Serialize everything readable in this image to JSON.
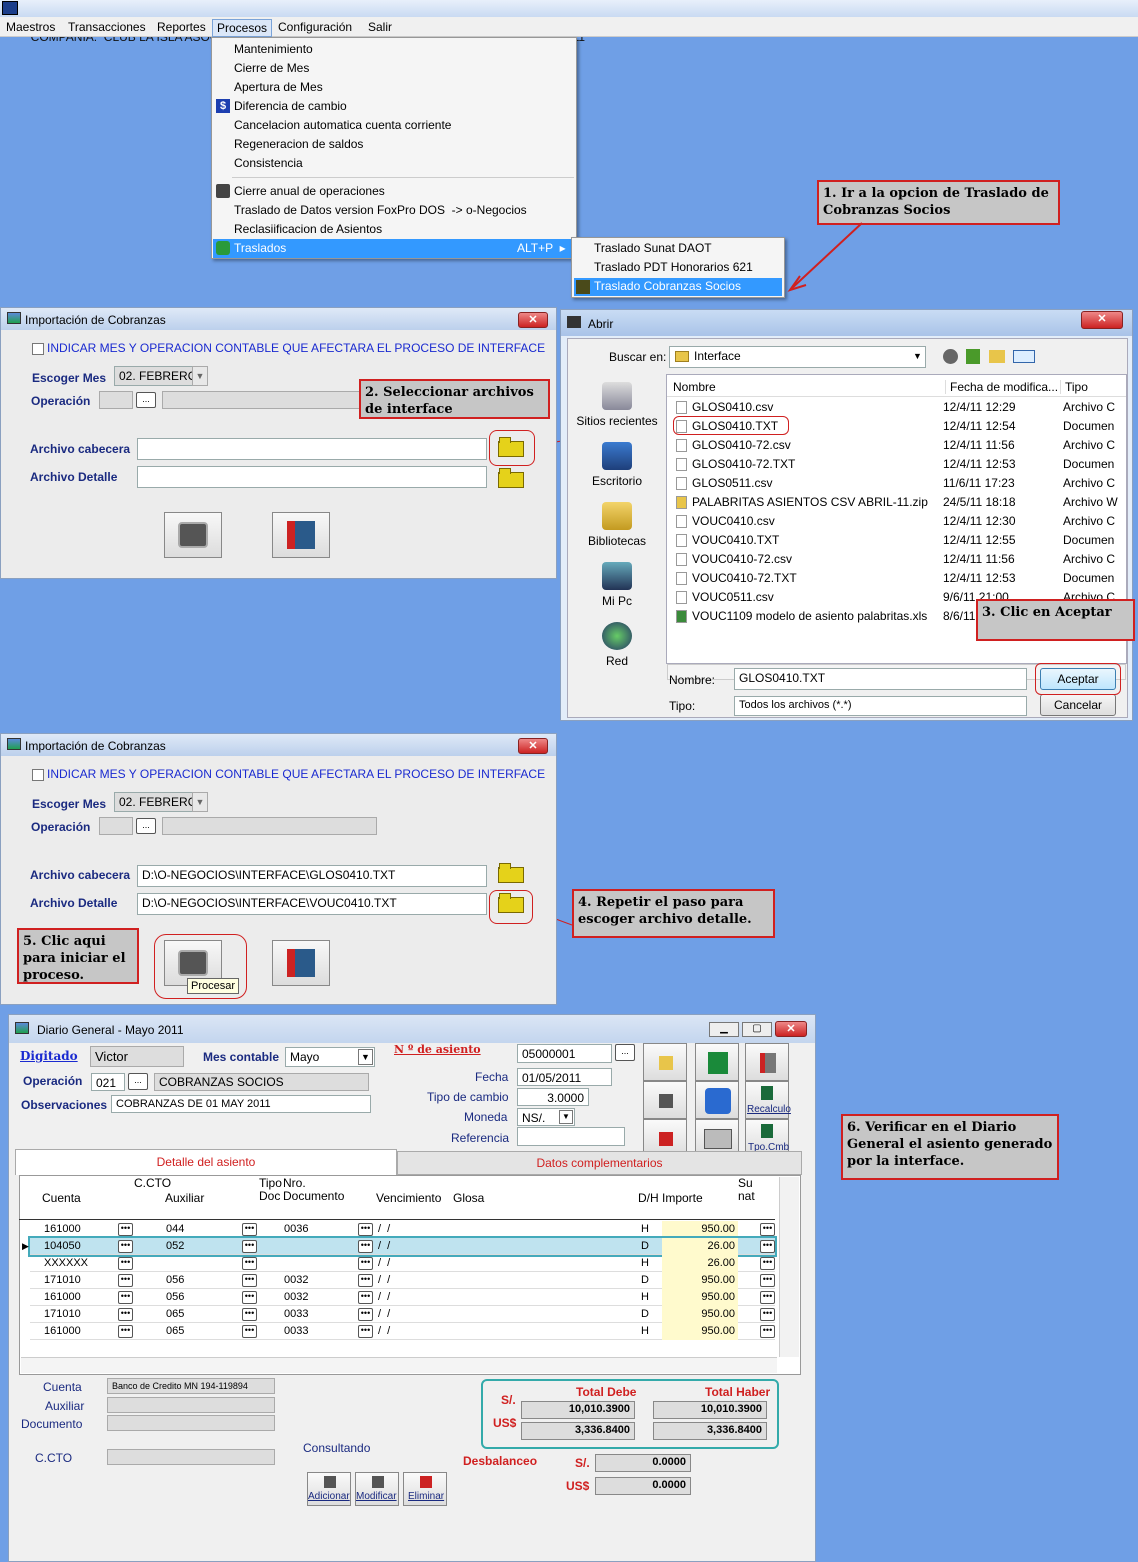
{
  "app": {
    "title": "COMPAÑIA:  CLUB LA ISLA ASOCIACION CIVIL   -   CONTABILIDAD   -   PERIODO: FEBRERO - 2011"
  },
  "menubar": [
    "Maestros",
    "Transacciones",
    "Reportes",
    "Procesos",
    "Configuración",
    "Salir"
  ],
  "procesos_menu": {
    "items": [
      "Mantenimiento",
      "Cierre de Mes",
      "Apertura de Mes",
      "Diferencia de cambio",
      "Cancelacion automatica cuenta corriente",
      "Regeneracion de saldos",
      "Consistencia",
      "Cierre anual de operaciones",
      "Traslado de Datos version FoxPro DOS  -> o-Negocios",
      "Reclasiificacion de Asientos",
      "Traslados"
    ],
    "traslados_shortcut": "ALT+P  ▸",
    "diferencia_icon_glyph": "$"
  },
  "traslados_submenu": [
    "Traslado Sunat DAOT",
    "Traslado PDT Honorarios 621",
    "Traslado Cobranzas Socios"
  ],
  "notes": {
    "n1": "1.  Ir a la opcion de Traslado de Cobranzas Socios",
    "n2": "2. Seleccionar archivos de interface",
    "n3": "3. Clic en Aceptar",
    "n4": "4. Repetir el paso para escoger archivo detalle.",
    "n5": "5. Clic aqui para iniciar el proceso.",
    "n6": "6. Verificar en el Diario General el asiento generado por la interface."
  },
  "import_win": {
    "title": "Importación de Cobranzas",
    "checkbox_label": "INDICAR MES Y OPERACION CONTABLE QUE AFECTARA EL PROCESO DE INTERFACE",
    "mes_label": "Escoger Mes",
    "mes_value": "02. FEBRERO",
    "operacion_label": "Operación",
    "operacion_btn": "...",
    "cab_label": "Archivo cabecera",
    "det_label": "Archivo Detalle",
    "cab_value_2": "D:\\O-NEGOCIOS\\INTERFACE\\GLOS0410.TXT",
    "det_value_2": "D:\\O-NEGOCIOS\\INTERFACE\\VOUC0410.TXT",
    "tooltip": "Procesar"
  },
  "abrir": {
    "title": "Abrir",
    "buscar_label": "Buscar en:",
    "buscar_value": "Interface",
    "side": [
      "Sitios recientes",
      "Escritorio",
      "Bibliotecas",
      "Mi Pc",
      "Red"
    ],
    "cols": [
      "Nombre",
      "Fecha de modifica...",
      "Tipo"
    ],
    "files": [
      {
        "name": "GLOS0410.csv",
        "date": "12/4/11 12:29",
        "type": "Archivo C"
      },
      {
        "name": "GLOS0410.TXT",
        "date": "12/4/11 12:54",
        "type": "Documen"
      },
      {
        "name": "GLOS0410-72.csv",
        "date": "12/4/11 11:56",
        "type": "Archivo C"
      },
      {
        "name": "GLOS0410-72.TXT",
        "date": "12/4/11 12:53",
        "type": "Documen"
      },
      {
        "name": "GLOS0511.csv",
        "date": "11/6/11 17:23",
        "type": "Archivo C"
      },
      {
        "name": "PALABRITAS ASIENTOS CSV ABRIL-11.zip",
        "date": "24/5/11 18:18",
        "type": "Archivo W"
      },
      {
        "name": "VOUC0410.csv",
        "date": "12/4/11 12:30",
        "type": "Archivo C"
      },
      {
        "name": "VOUC0410.TXT",
        "date": "12/4/11 12:55",
        "type": "Documen"
      },
      {
        "name": "VOUC0410-72.csv",
        "date": "12/4/11 11:56",
        "type": "Archivo C"
      },
      {
        "name": "VOUC0410-72.TXT",
        "date": "12/4/11 12:53",
        "type": "Documen"
      },
      {
        "name": "VOUC0511.csv",
        "date": "9/6/11 21:00",
        "type": "Archivo C"
      },
      {
        "name": "VOUC1109 modelo de asiento palabritas.xls",
        "date": "8/6/11",
        "type": ""
      }
    ],
    "nombre_label": "Nombre:",
    "nombre_value": "GLOS0410.TXT",
    "tipo_label": "Tipo:",
    "tipo_value": "Todos los archivos (*.*)",
    "ok": "Aceptar",
    "cancel": "Cancelar"
  },
  "diario": {
    "title": "Diario General   - Mayo 2011",
    "digitado_label": "Digitado",
    "digitado_value": "Victor",
    "mes_label": "Mes contable",
    "mes_value": "Mayo",
    "asiento_label": "N º de asiento",
    "asiento_value": "05000001",
    "operacion_label": "Operación",
    "operacion_code": "021",
    "operacion_name": "COBRANZAS SOCIOS",
    "obs_label": "Observaciones",
    "obs_value": "COBRANZAS DE 01 MAY 2011",
    "fecha_label": "Fecha",
    "fecha_value": "01/05/2011",
    "tc_label": "Tipo de cambio",
    "tc_value": "3.0000",
    "moneda_label": "Moneda",
    "moneda_value": "NS/.",
    "ref_label": "Referencia",
    "btn_recalculo": "Recalculo",
    "btn_tpocmb": "Tpo.Cmb",
    "tab1": "Detalle del asiento",
    "tab2": "Datos complementarios",
    "col_hdrs": {
      "cuenta": "Cuenta",
      "cto": "C.CTO",
      "aux": "Auxiliar",
      "tipo": "Tipo\nDoc",
      "nro": "Nro.\nDocumento",
      "venc": "Vencimiento",
      "glosa": "Glosa",
      "dh": "D/H",
      "imp": "Importe",
      "su": "Su\nnat"
    },
    "rows": [
      {
        "cuenta": "161000",
        "aux": "044",
        "doc": "0036",
        "venc": "/  /",
        "dh": "H",
        "imp": "950.00"
      },
      {
        "cuenta": "104050",
        "aux": "052",
        "doc": "",
        "venc": "/  /",
        "dh": "D",
        "imp": "26.00"
      },
      {
        "cuenta": "XXXXXX",
        "aux": "",
        "doc": "",
        "venc": "/  /",
        "dh": "H",
        "imp": "26.00"
      },
      {
        "cuenta": "171010",
        "aux": "056",
        "doc": "0032",
        "venc": "/  /",
        "dh": "D",
        "imp": "950.00"
      },
      {
        "cuenta": "161000",
        "aux": "056",
        "doc": "0032",
        "venc": "/  /",
        "dh": "H",
        "imp": "950.00"
      },
      {
        "cuenta": "171010",
        "aux": "065",
        "doc": "0033",
        "venc": "/  /",
        "dh": "D",
        "imp": "950.00"
      },
      {
        "cuenta": "161000",
        "aux": "065",
        "doc": "0033",
        "venc": "/  /",
        "dh": "H",
        "imp": "950.00"
      }
    ],
    "cuenta_label": "Cuenta",
    "cuenta_desc": "Banco de Credito MN 194-119894",
    "aux_label": "Auxiliar",
    "doc_label": "Documento",
    "cto_label": "C.CTO",
    "consultando": "Consultando",
    "total_debe": "Total Debe",
    "total_haber": "Total Haber",
    "soles": "S/.",
    "dolares": "US$",
    "debe_sol": "10,010.3900",
    "haber_sol": "10,010.3900",
    "debe_usd": "3,336.8400",
    "haber_usd": "3,336.8400",
    "desbalanceo": "Desbalanceo",
    "desb_sol": "0.0000",
    "desb_usd": "0.0000",
    "btn_add": "Adicionar",
    "btn_mod": "Modificar",
    "btn_del": "Eliminar"
  }
}
